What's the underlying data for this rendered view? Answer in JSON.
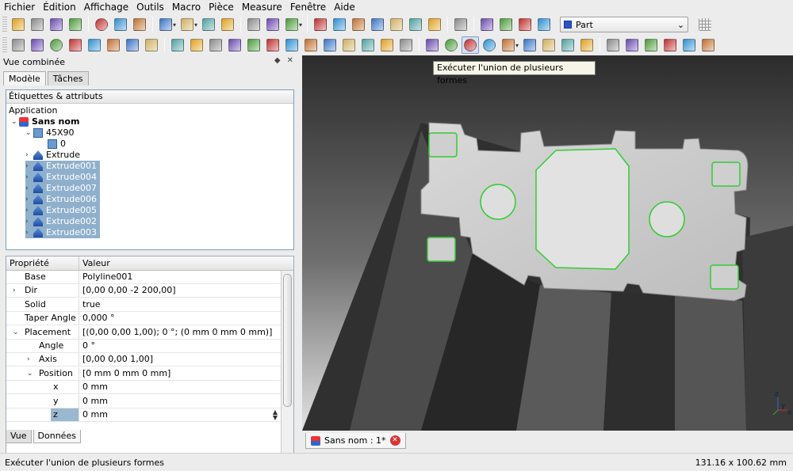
{
  "menubar": [
    {
      "name": "fichier",
      "label": "Fichier"
    },
    {
      "name": "edition",
      "label": "Édition"
    },
    {
      "name": "affichage",
      "label": "Affichage"
    },
    {
      "name": "outils",
      "label": "Outils"
    },
    {
      "name": "macro",
      "label": "Macro"
    },
    {
      "name": "piece",
      "label": "Pièce"
    },
    {
      "name": "measure",
      "label": "Measure"
    },
    {
      "name": "fenetre",
      "label": "Fenêtre"
    },
    {
      "name": "aide",
      "label": "Aide"
    }
  ],
  "workbench": {
    "selected": "Part"
  },
  "tooltip": "Exécuter l'union de plusieurs formes",
  "combo": {
    "title": "Vue combinée",
    "float_glyph": "◆",
    "close_glyph": "✕",
    "tab_model": "Modèle",
    "tab_tasks": "Tâches"
  },
  "tree": {
    "header": "Étiquettes & attributs",
    "root": "Application",
    "document": "Sans nom",
    "group": "45X90",
    "group_child": "0",
    "items": [
      {
        "label": "Extrude",
        "selected": false
      },
      {
        "label": "Extrude001",
        "selected": true
      },
      {
        "label": "Extrude004",
        "selected": true
      },
      {
        "label": "Extrude007",
        "selected": true
      },
      {
        "label": "Extrude006",
        "selected": true
      },
      {
        "label": "Extrude005",
        "selected": true
      },
      {
        "label": "Extrude002",
        "selected": true
      },
      {
        "label": "Extrude003",
        "selected": true
      }
    ]
  },
  "properties": {
    "col_property": "Propriété",
    "col_value": "Valeur",
    "rows": [
      {
        "name": "Base",
        "value": "Polyline001"
      },
      {
        "name": "Dir",
        "value": "[0,00 0,00 -2 200,00]"
      },
      {
        "name": "Solid",
        "value": "true"
      },
      {
        "name": "Taper Angle",
        "value": "0,000 °"
      },
      {
        "name": "Placement",
        "value": "[(0,00 0,00 1,00); 0 °; (0 mm  0 mm  0 mm)]"
      },
      {
        "name": "Angle",
        "value": "0 °"
      },
      {
        "name": "Axis",
        "value": "[0,00 0,00 1,00]"
      },
      {
        "name": "Position",
        "value": "[0 mm  0 mm  0 mm]"
      },
      {
        "name": "x",
        "value": "0 mm"
      },
      {
        "name": "y",
        "value": "0 mm"
      },
      {
        "name": "z",
        "value": "0 mm"
      }
    ]
  },
  "bottom_tabs": {
    "view": "Vue",
    "data": "Données"
  },
  "document_tab": {
    "label": "Sans nom : 1*",
    "close": "✕"
  },
  "statusbar": {
    "message": "Exécuter l'union de plusieurs formes",
    "dimensions": "131.16 x 100.62 mm"
  },
  "axis": {
    "x": "x",
    "y": "y",
    "z": "z"
  },
  "toolbar1_icons": [
    "new-document-icon",
    "open-icon",
    "save-icon",
    "print-icon",
    "cut-icon",
    "copy-icon",
    "paste-icon",
    "undo-icon",
    "redo-icon",
    "refresh-icon",
    "whats-this-icon",
    "fit-all-icon",
    "fit-selection-icon",
    "draw-style-icon",
    "isometric-view-icon",
    "front-view-icon",
    "top-view-icon",
    "right-view-icon",
    "rear-view-icon",
    "bottom-view-icon",
    "left-view-icon",
    "measure-distance-icon",
    "macro-record-icon",
    "macro-stop-icon",
    "macro-edit-icon",
    "macro-run-icon"
  ],
  "toolbar2_icons": [
    "box-icon",
    "cylinder-icon",
    "sphere-icon",
    "cone-icon",
    "torus-icon",
    "tube-icon",
    "primitives-icon",
    "shape-builder-icon",
    "extrude-icon",
    "revolve-icon",
    "mirror-icon",
    "fillet-icon",
    "chamfer-icon",
    "make-face-icon",
    "ruled-surface-icon",
    "loft-icon",
    "sweep-icon",
    "section-icon",
    "cross-sections-icon",
    "offset-icon",
    "thickness-icon",
    "boolean-icon",
    "cut-icon",
    "fuse-icon",
    "common-icon",
    "join-icon",
    "split-icon",
    "compound-icon",
    "check-geometry-icon",
    "defeaturing-icon",
    "measure-linear-icon",
    "measure-angular-icon",
    "measure-refresh-icon",
    "toggle-3d-icon",
    "toggle-delta-icon",
    "clear-all-icon"
  ],
  "colors": {
    "accent": "#2a55c9",
    "selection": "#8fb0cc",
    "highlight": "#33cc33"
  }
}
